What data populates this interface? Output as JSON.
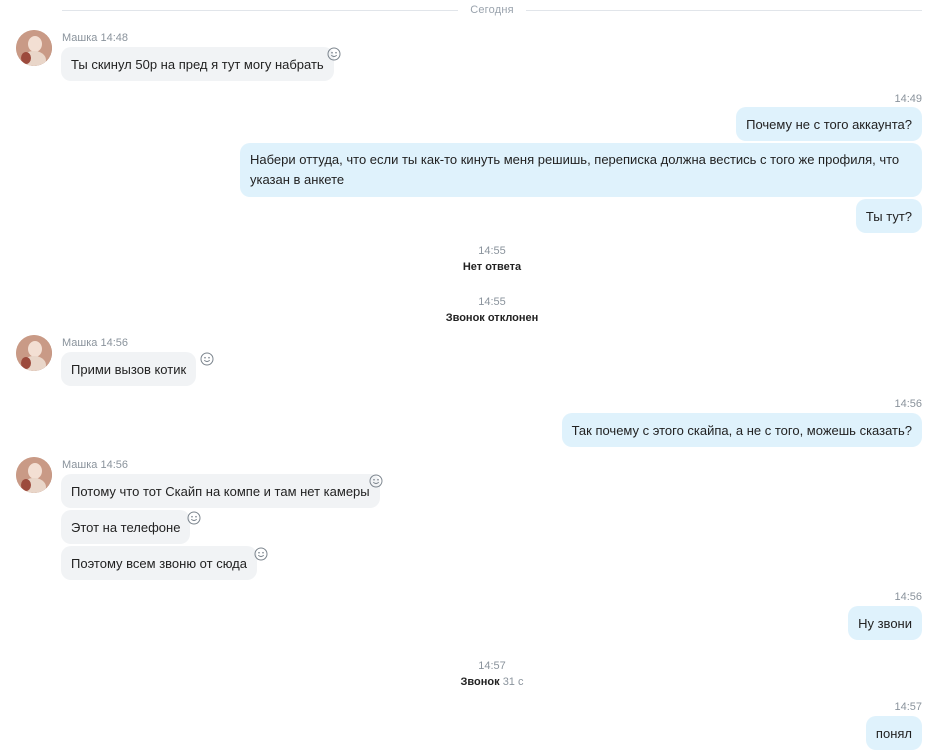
{
  "divider": {
    "label": "Сегодня"
  },
  "contact": {
    "name": "Машка"
  },
  "messages": {
    "m1": {
      "sender": "Машка",
      "time": "14:48",
      "text": "Ты скинул 50р на пред я тут могу набрать"
    },
    "o1": {
      "time": "14:49",
      "text": "Почему не с того аккаунта?"
    },
    "o2": {
      "text": "Набери оттуда, что если ты как-то кинуть меня решишь, переписка должна вестись с того же профиля, что указан в анкете"
    },
    "o3": {
      "text": "Ты тут?"
    },
    "s1": {
      "time": "14:55",
      "text": "Нет ответа"
    },
    "s2": {
      "time": "14:55",
      "text": "Звонок отклонен"
    },
    "m2": {
      "sender": "Машка",
      "time": "14:56",
      "text": "Прими вызов котик"
    },
    "o4": {
      "time": "14:56",
      "text": "Так почему с этого скайпа, а не с того, можешь сказать?"
    },
    "m3": {
      "sender": "Машка",
      "time": "14:56",
      "text": "Потому что тот Скайп на компе и там нет камеры"
    },
    "m4": {
      "text": "Этот на телефоне"
    },
    "m5": {
      "text": "Поэтому всем звоню от сюда"
    },
    "o5": {
      "time": "14:56",
      "text": "Ну звони"
    },
    "s3": {
      "time": "14:57",
      "text": "Звонок",
      "duration": "31 с"
    },
    "o6": {
      "time": "14:57",
      "text": "понял"
    }
  },
  "icons": {
    "reaction": "smiley-icon",
    "avatar": "contact-avatar"
  },
  "colors": {
    "incoming_bubble": "#f1f3f5",
    "outgoing_bubble": "#dff2fc",
    "meta_text": "#8a939c"
  }
}
